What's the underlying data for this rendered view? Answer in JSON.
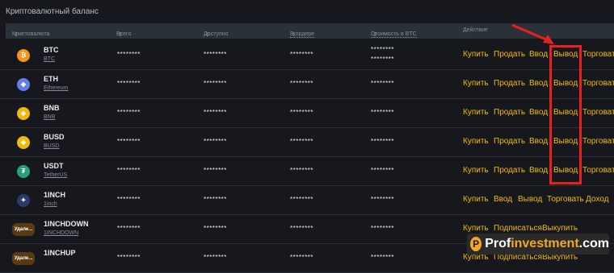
{
  "page_title": "Криптовалютный баланс",
  "columns": {
    "currency": "Криптовалюта",
    "total": "Всего",
    "available": "Доступно",
    "in_orders": "В ордере",
    "btc_value": "Стоимость в BTC",
    "action": "Действие"
  },
  "masked": "********",
  "rows": [
    {
      "symbol": "BTC",
      "name": "BTC",
      "icon": "bitcoin-icon",
      "color": "#f7931a",
      "glyph": "₿",
      "actions": [
        "Купить",
        "Продать",
        "Ввод",
        "Вывод",
        "Торговать"
      ]
    },
    {
      "symbol": "ETH",
      "name": "Ethereum",
      "icon": "ethereum-icon",
      "color": "#627eea",
      "glyph": "◆",
      "actions": [
        "Купить",
        "Продать",
        "Ввод",
        "Вывод",
        "Торговать"
      ]
    },
    {
      "symbol": "BNB",
      "name": "BNB",
      "icon": "bnb-icon",
      "color": "#f0b90b",
      "glyph": "◈",
      "actions": [
        "Купить",
        "Продать",
        "Ввод",
        "Вывод",
        "Торговать"
      ]
    },
    {
      "symbol": "BUSD",
      "name": "BUSD",
      "icon": "busd-icon",
      "color": "#f0b90b",
      "glyph": "◈",
      "actions": [
        "Купить",
        "Продать",
        "Ввод",
        "Вывод",
        "Торговать"
      ]
    },
    {
      "symbol": "USDT",
      "name": "TetherUS",
      "icon": "tether-icon",
      "color": "#26a17b",
      "glyph": "₮",
      "actions": [
        "Купить",
        "Продать",
        "Ввод",
        "Вывод",
        "Торговать"
      ]
    },
    {
      "symbol": "1INCH",
      "name": "1inch",
      "icon": "1inch-icon",
      "color": "#2a3b6b",
      "glyph": "✦",
      "actions": [
        "Купить",
        "Ввод",
        "Вывод",
        "Торговать",
        "Доход"
      ]
    },
    {
      "symbol": "1INCHDOWN",
      "name": "1INCHDOWN",
      "icon": "delisted-token-icon",
      "color": "#5a3a10",
      "glyph": "Удале...",
      "actions": [
        "Купить",
        "Подписаться",
        "Выкупить"
      ]
    },
    {
      "symbol": "1INCHUP",
      "name": "",
      "icon": "delisted-token-icon",
      "color": "#5a3a10",
      "glyph": "Удале...",
      "actions": [
        "Купить",
        "Подписаться",
        "Выкупить"
      ]
    }
  ],
  "watermark": {
    "prefix": "Prof",
    "middle": "investment",
    "suffix": ".com",
    "logo_glyph": "P"
  },
  "colors": {
    "accent": "#f0b90b",
    "highlight": "#e8201f",
    "background": "#16181d"
  }
}
